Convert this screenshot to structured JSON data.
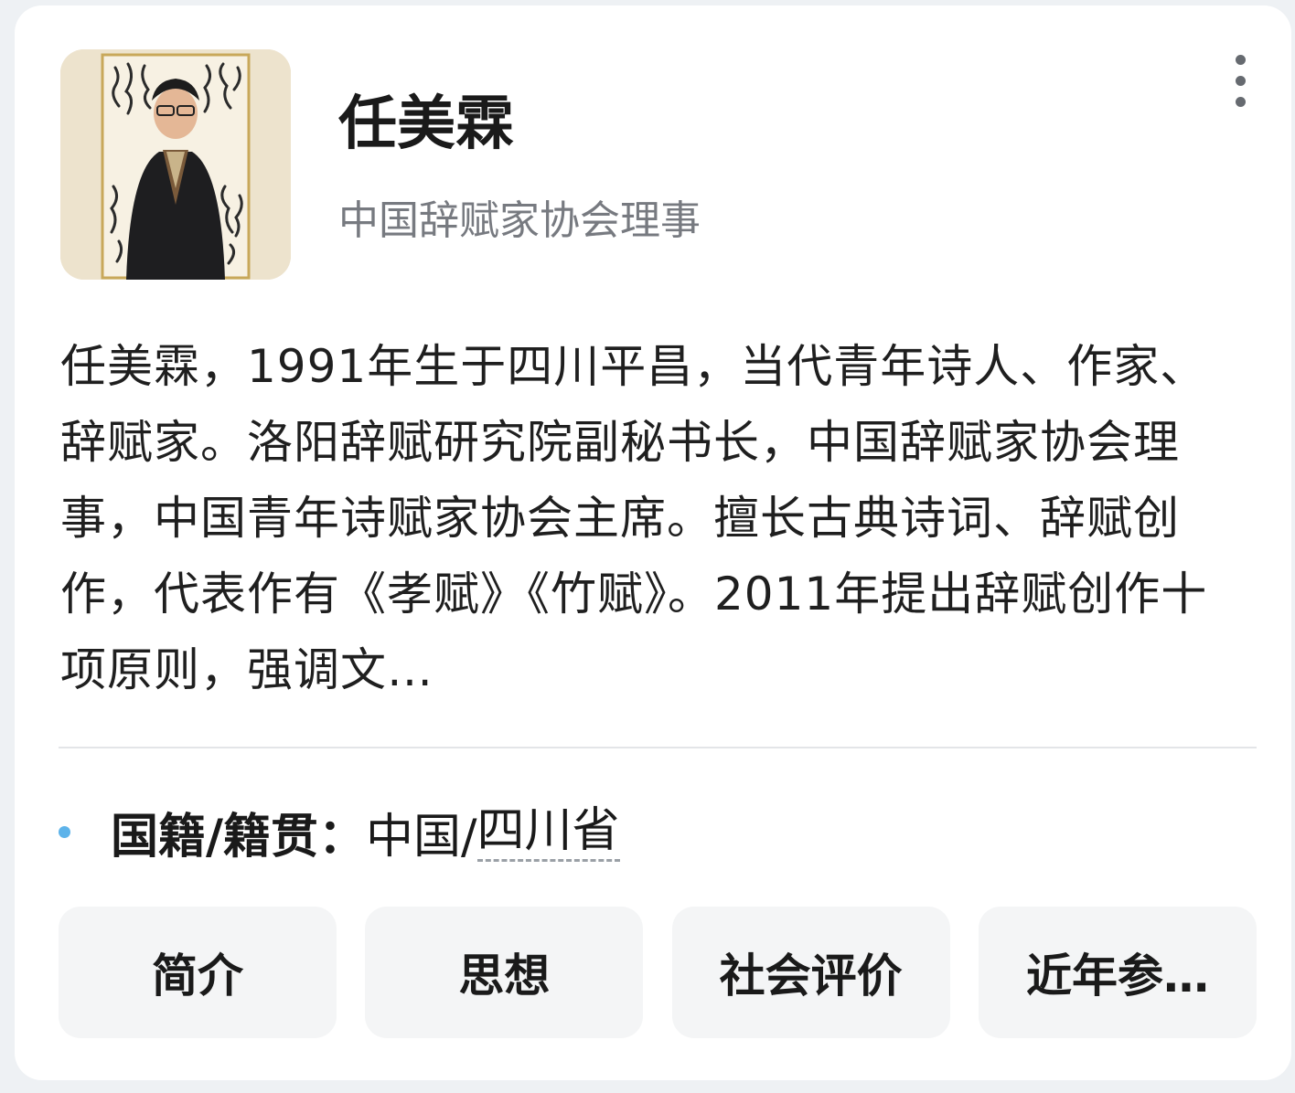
{
  "profile": {
    "name": "任美霖",
    "title": "中国辞赋家协会理事",
    "description": "任美霖，1991年生于四川平昌，当代青年诗人、作家、辞赋家。洛阳辞赋研究院副秘书长，中国辞赋家协会理事，中国青年诗赋家协会主席。擅长古典诗词、辞赋创作，代表作有《孝赋》《竹赋》。2011年提出辞赋创作十项原则，强调文…",
    "avatar_icon": "person-photo-icon"
  },
  "menu": {
    "icon": "more-vertical-icon"
  },
  "facts": [
    {
      "label": "国籍/籍贯：",
      "value_prefix": "中国/",
      "value_link": "四川省"
    }
  ],
  "tabs": [
    {
      "label": "简介"
    },
    {
      "label": "思想"
    },
    {
      "label": "社会评价"
    },
    {
      "label": "近年参…"
    }
  ],
  "colors": {
    "bullet": "#5db3ea",
    "subtitle": "#777a80",
    "tab_bg": "#f4f5f6"
  }
}
